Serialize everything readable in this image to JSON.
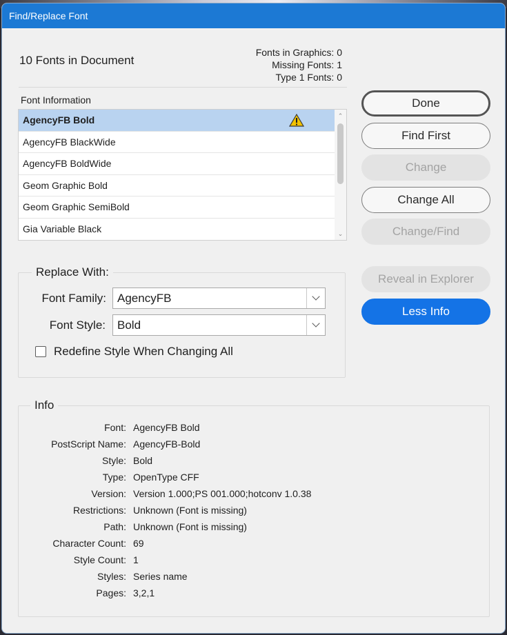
{
  "window": {
    "title": "Find/Replace Font"
  },
  "summary": {
    "fonts_in_document": "10 Fonts in Document",
    "fonts_in_graphics": "Fonts in Graphics: 0",
    "missing_fonts": "Missing Fonts: 1",
    "type1_fonts": "Type 1 Fonts: 0"
  },
  "font_list": {
    "header": "Font Information",
    "items": [
      {
        "label": "AgencyFB Bold",
        "selected": true,
        "warning": true
      },
      {
        "label": "AgencyFB BlackWide"
      },
      {
        "label": "AgencyFB BoldWide"
      },
      {
        "label": "Geom Graphic Bold"
      },
      {
        "label": "Geom Graphic SemiBold"
      },
      {
        "label": "Gia Variable Black"
      }
    ],
    "warning_icon": "warning-triangle-icon"
  },
  "buttons": {
    "done": "Done",
    "find_first": "Find First",
    "change": "Change",
    "change_all": "Change All",
    "change_find": "Change/Find",
    "reveal": "Reveal in Explorer",
    "less_info": "Less Info"
  },
  "replace": {
    "legend": "Replace With:",
    "family_label": "Font Family:",
    "family_value": "AgencyFB",
    "style_label": "Font Style:",
    "style_value": "Bold",
    "redefine_label": "Redefine Style When Changing All",
    "redefine_checked": false
  },
  "info": {
    "legend": "Info",
    "rows": [
      {
        "key": "Font:",
        "value": "AgencyFB Bold"
      },
      {
        "key": "PostScript Name:",
        "value": "AgencyFB-Bold"
      },
      {
        "key": "Style:",
        "value": "Bold"
      },
      {
        "key": "Type:",
        "value": "OpenType CFF"
      },
      {
        "key": "Version:",
        "value": "Version 1.000;PS 001.000;hotconv 1.0.38"
      },
      {
        "key": "Restrictions:",
        "value": "Unknown (Font is missing)"
      },
      {
        "key": "Path:",
        "value": "Unknown (Font is missing)"
      },
      {
        "key": "Character Count:",
        "value": "69"
      },
      {
        "key": "Style Count:",
        "value": "1"
      },
      {
        "key": "Styles:",
        "value": "Series name"
      },
      {
        "key": "Pages:",
        "value": "3,2,1"
      }
    ]
  },
  "colors": {
    "titlebar": "#1c79d4",
    "selection": "#b9d3f0",
    "accent_button": "#1473e6",
    "warning": "#f2c200"
  }
}
